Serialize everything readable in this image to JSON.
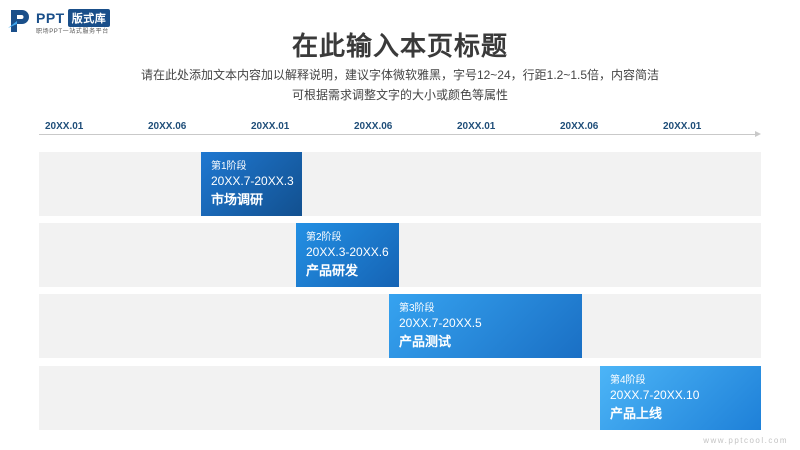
{
  "logo": {
    "brand": "PPT",
    "badge": "版式库",
    "tagline": "职场PPT一站式服务平台"
  },
  "header": {
    "title": "在此输入本页标题",
    "desc_line1": "请在此处添加文本内容加以解释说明，建议字体微软雅黑，字号12~24，行距1.2~1.5倍，内容简洁",
    "desc_line2": "可根据需求调整文字的大小或颜色等属性"
  },
  "timeline": {
    "ticks": [
      "20XX.01",
      "20XX.06",
      "20XX.01",
      "20XX.06",
      "20XX.01",
      "20XX.06",
      "20XX.01"
    ],
    "stages": [
      {
        "label": "第1阶段",
        "date": "20XX.7-20XX.3",
        "name": "市场调研"
      },
      {
        "label": "第2阶段",
        "date": "20XX.3-20XX.6",
        "name": "产品研发"
      },
      {
        "label": "第3阶段",
        "date": "20XX.7-20XX.5",
        "name": "产品测试"
      },
      {
        "label": "第4阶段",
        "date": "20XX.7-20XX.10",
        "name": "产品上线"
      }
    ]
  },
  "colors": {
    "accent_dark": "#12508f",
    "accent_light": "#4cb5f7",
    "row_bg": "#f2f2f2",
    "tick_text": "#1f4e79"
  },
  "watermark": "www.pptcool.com"
}
